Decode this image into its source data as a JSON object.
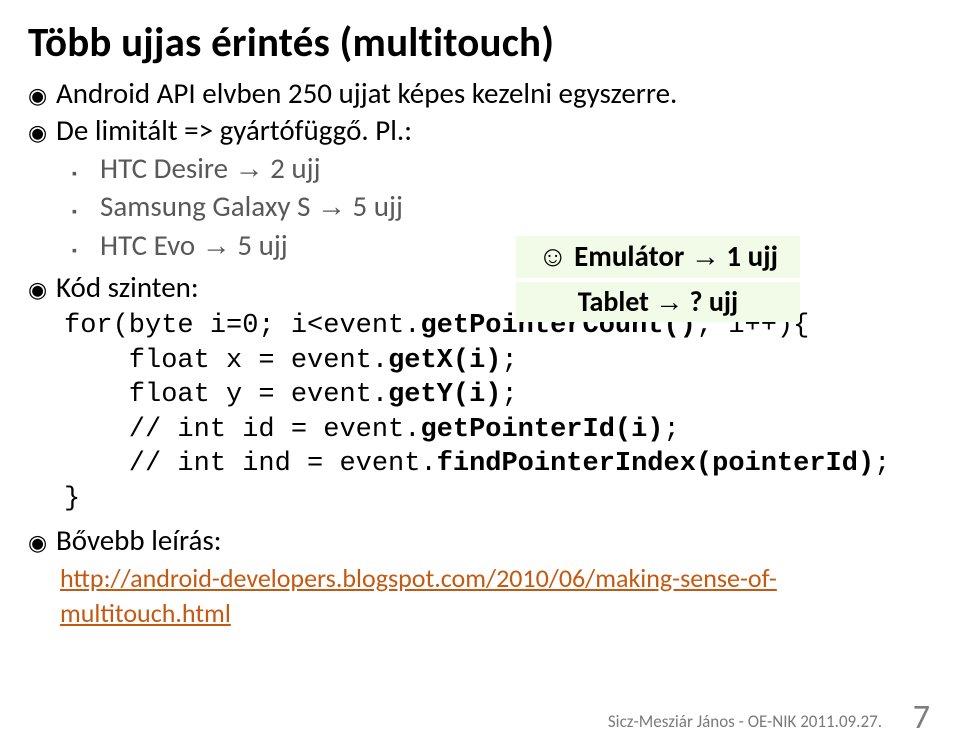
{
  "title": "Több ujjas érintés (multitouch)",
  "p1": "Android  API elvben 250 ujjat képes kezelni egyszerre.",
  "p2": "De limitált => gyártófüggő. Pl.:",
  "dev1_a": "HTC Desire ",
  "dev1_b": " 2 ujj",
  "dev2_a": "Samsung Galaxy S ",
  "dev2_b": " 5 ujj",
  "dev3_a": "HTC Evo ",
  "dev3_b": " 5 ujj",
  "h1_a": "☺ Emulátor ",
  "h1_b": " 1 ujj",
  "h2_a": "Tablet ",
  "h2_b": " ? ujj",
  "p3": "Kód szinten:",
  "code_l1_a": "for(byte i=0; i<event.",
  "code_l1_b": "getPointerCount()",
  "code_l1_c": "; i++){",
  "code_l2_a": "    float x = event.",
  "code_l2_b": "getX(i)",
  "code_l2_c": ";",
  "code_l3_a": "    float y = event.",
  "code_l3_b": "getY(i)",
  "code_l3_c": ";",
  "code_l4_a": "    // int id = event.",
  "code_l4_b": "getPointerId(i)",
  "code_l4_c": ";",
  "code_l5_a": "    // int ind = event.",
  "code_l5_b": "findPointerIndex(pointerId)",
  "code_l5_c": ";",
  "code_l6": "}",
  "p4": "Bővebb leírás:",
  "link_text": "http://android-developers.blogspot.com/2010/06/making-sense-of-multitouch.html",
  "footer": "Sicz-Mesziár János - OE-NIK        2011.09.27.",
  "pagenum": "7",
  "bullets": {
    "dot": "◉",
    "sq": "▪",
    "arr": "→"
  }
}
